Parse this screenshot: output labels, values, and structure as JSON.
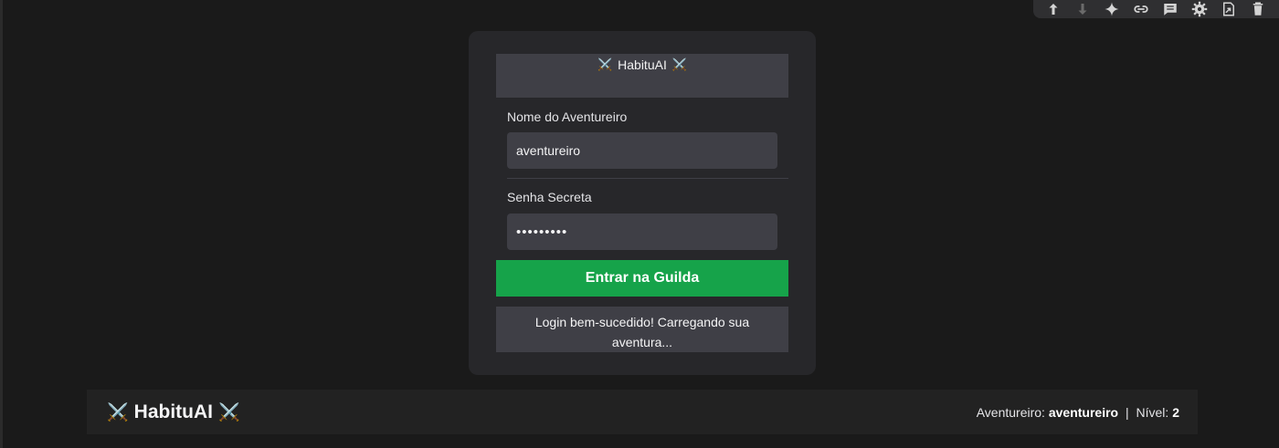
{
  "toolbar": {
    "buttons": [
      {
        "icon": "arrow-up-icon"
      },
      {
        "icon": "arrow-down-icon"
      },
      {
        "icon": "sparkle-icon"
      },
      {
        "icon": "link-icon"
      },
      {
        "icon": "comment-icon"
      },
      {
        "icon": "gear-icon"
      },
      {
        "icon": "mirror-cell-icon"
      },
      {
        "icon": "trash-icon"
      }
    ]
  },
  "login": {
    "header_icon": "⚔️",
    "header_title": "HabituAI",
    "username_label": "Nome do Aventureiro",
    "username_value": "aventureiro",
    "password_label": "Senha Secreta",
    "password_value": "•••••••••",
    "submit_label": "Entrar na Guilda",
    "status_message": "Login bem-sucedido! Carregando sua aventura...",
    "colors": {
      "submit": "#16a34a",
      "field": "#3f3f46",
      "card": "#27272a"
    }
  },
  "app_header": {
    "icon": "⚔️",
    "title": "HabituAI",
    "user_label": "Aventureiro:",
    "username": "aventureiro",
    "separator": "|",
    "level_label": "Nível:",
    "level": "2"
  }
}
